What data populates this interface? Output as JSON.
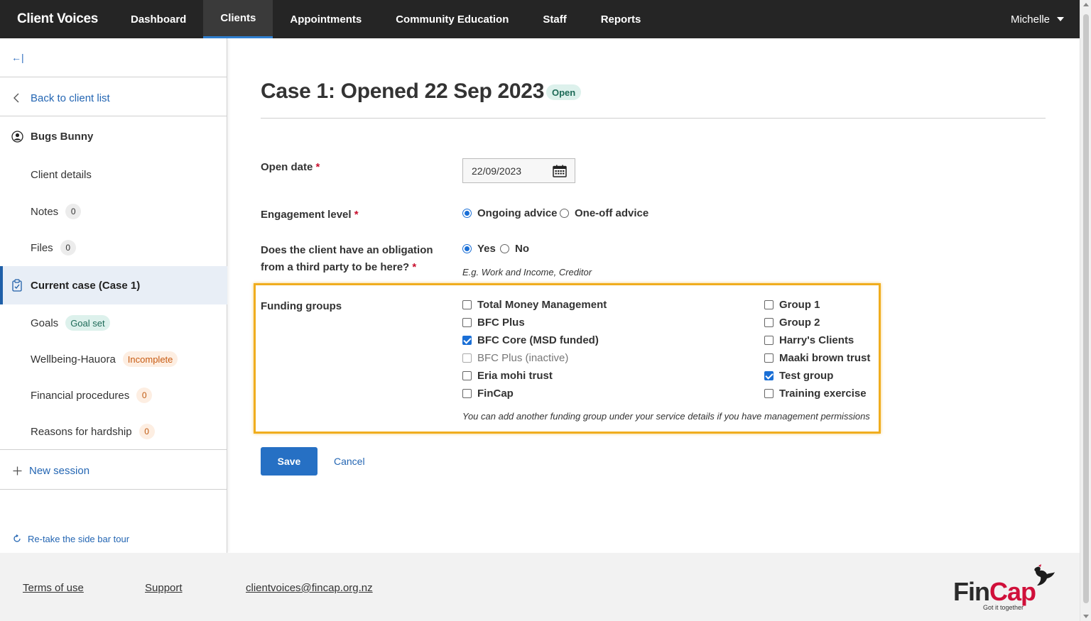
{
  "nav": {
    "brand": "Client Voices",
    "items": [
      "Dashboard",
      "Clients",
      "Appointments",
      "Community Education",
      "Staff",
      "Reports"
    ],
    "active": "Clients",
    "user": "Michelle"
  },
  "sidebar": {
    "collapse_icon": "←|",
    "back_link": "Back to client list",
    "client_name": "Bugs Bunny",
    "client_details": "Client details",
    "notes": {
      "label": "Notes",
      "count": "0"
    },
    "files": {
      "label": "Files",
      "count": "0"
    },
    "current_case": "Current case (Case 1)",
    "goals": {
      "label": "Goals",
      "badge": "Goal set"
    },
    "wellbeing": {
      "label": "Wellbeing-Hauora",
      "badge": "Incomplete"
    },
    "financial": {
      "label": "Financial procedures",
      "count": "0"
    },
    "hardship": {
      "label": "Reasons for hardship",
      "count": "0"
    },
    "new_session": "New session",
    "retake_tour": "Re-take the side bar tour"
  },
  "main": {
    "title": "Case 1: Opened 22 Sep 2023",
    "status": "Open",
    "open_date_label": "Open date",
    "open_date_value": "22/09/2023",
    "engagement_label": "Engagement level",
    "engagement_options": [
      "Ongoing advice",
      "One-off advice"
    ],
    "engagement_selected": "Ongoing advice",
    "obligation_label_line1": "Does the client have an obligation",
    "obligation_label_line2": "from a third party to be here?",
    "obligation_options": [
      "Yes",
      "No"
    ],
    "obligation_selected": "Yes",
    "obligation_hint": "E.g. Work and Income, Creditor",
    "required_marker": "*",
    "funding_label": "Funding groups",
    "funding_left": [
      {
        "label": "Total Money Management",
        "checked": false,
        "disabled": false
      },
      {
        "label": "BFC Plus",
        "checked": false,
        "disabled": false
      },
      {
        "label": "BFC Core (MSD funded)",
        "checked": true,
        "disabled": false
      },
      {
        "label": "BFC Plus (inactive)",
        "checked": false,
        "disabled": true
      },
      {
        "label": "Eria mohi trust",
        "checked": false,
        "disabled": false
      },
      {
        "label": "FinCap",
        "checked": false,
        "disabled": false
      }
    ],
    "funding_right": [
      {
        "label": "Group 1",
        "checked": false
      },
      {
        "label": "Group 2",
        "checked": false
      },
      {
        "label": "Harry's Clients",
        "checked": false
      },
      {
        "label": "Maaki brown trust",
        "checked": false
      },
      {
        "label": "Test group",
        "checked": true
      },
      {
        "label": "Training exercise",
        "checked": false
      }
    ],
    "funding_hint": "You can add another funding group under your service details if you have management permissions",
    "save_label": "Save",
    "cancel_label": "Cancel"
  },
  "footer": {
    "terms": "Terms of use",
    "support": "Support",
    "email": "clientvoices@fincap.org.nz",
    "logo_text": "FinCap",
    "logo_tagline": "Got it together"
  },
  "colors": {
    "accent": "#2670c4",
    "focus": "#f0ad1e",
    "nav_bg": "#252525"
  }
}
